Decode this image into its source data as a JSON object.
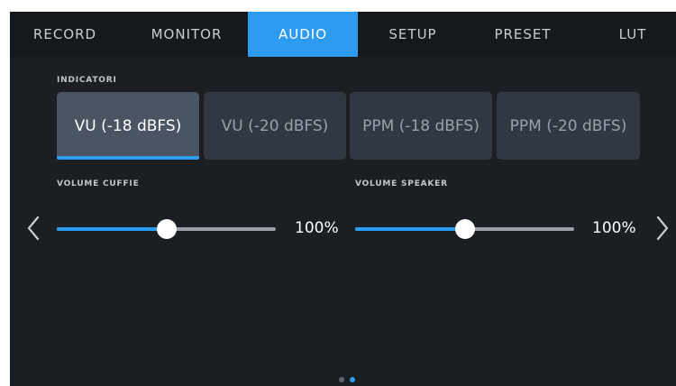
{
  "tabs": [
    {
      "label": "RECORD",
      "active": false
    },
    {
      "label": "MONITOR",
      "active": false
    },
    {
      "label": "AUDIO",
      "active": true
    },
    {
      "label": "SETUP",
      "active": false
    },
    {
      "label": "PRESET",
      "active": false
    },
    {
      "label": "LUT",
      "active": false
    }
  ],
  "indicators": {
    "label": "INDICATORI",
    "options": [
      "VU (-18 dBFS)",
      "VU (-20 dBFS)",
      "PPM (-18 dBFS)",
      "PPM (-20 dBFS)"
    ],
    "selected_index": 0
  },
  "headphone_volume": {
    "label": "VOLUME CUFFIE",
    "value_text": "100%",
    "level": 0.5
  },
  "speaker_volume": {
    "label": "VOLUME SPEAKER",
    "value_text": "100%",
    "level": 0.5
  },
  "pagination": {
    "pages": 2,
    "current": 2
  },
  "colors": {
    "accent": "#2d9bf0",
    "background": "#1b1f24",
    "tab_bar": "#15181c",
    "segment": "#323841",
    "segment_selected": "#4a5463"
  },
  "icons": {
    "prev": "chevron-left-icon",
    "next": "chevron-right-icon"
  }
}
